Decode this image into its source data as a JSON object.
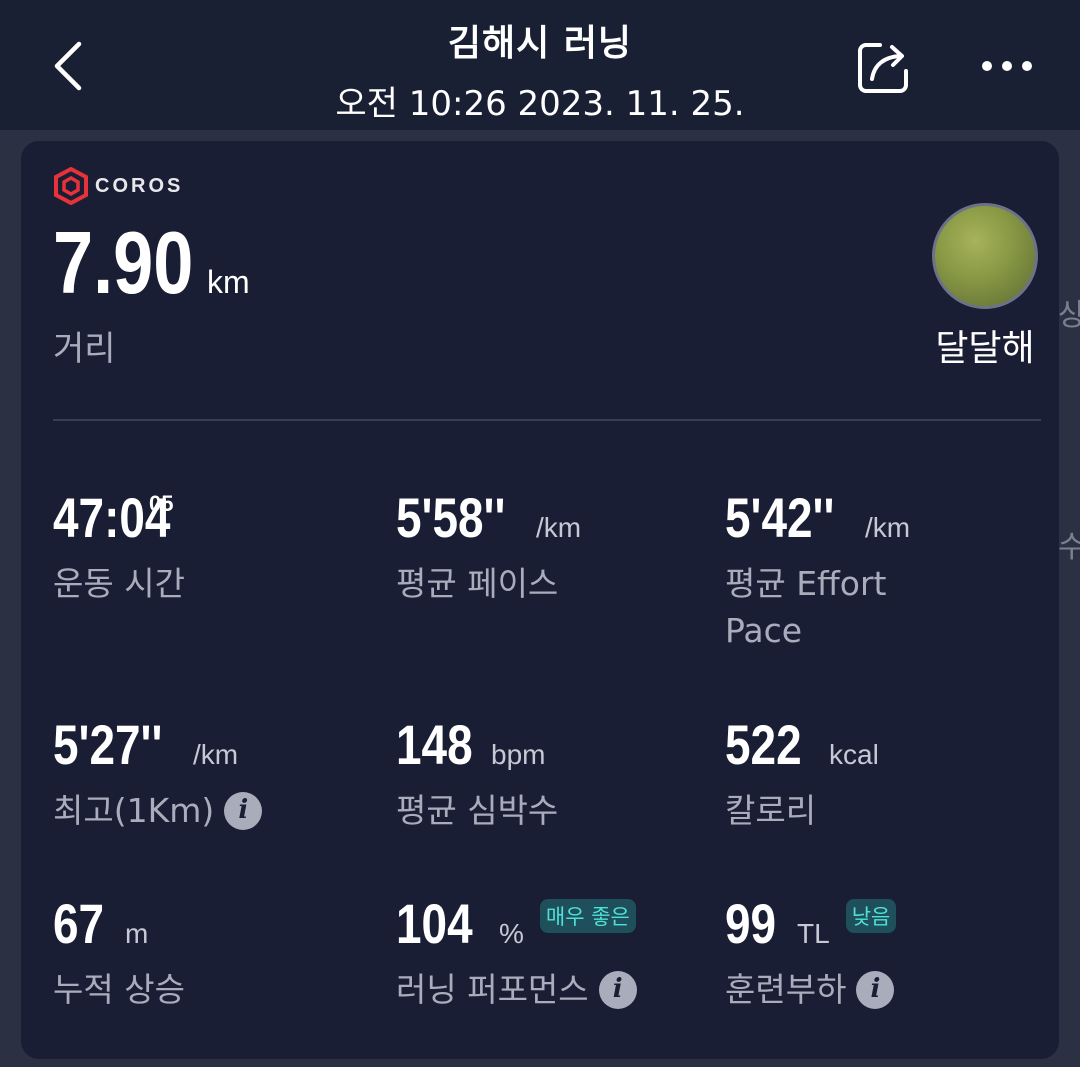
{
  "header": {
    "title": "김해시 러닝",
    "datetime": "오전 10:26 2023. 11. 25.",
    "back_icon": "chevron-left-icon",
    "share_icon": "share-icon",
    "more_icon": "more-horizontal-icon"
  },
  "map_edge": [
    "상",
    "수"
  ],
  "card": {
    "brand": "COROS",
    "brand_color": "#e8323a",
    "distance": {
      "value": "7.90",
      "unit": "km",
      "label": "거리"
    },
    "feel": {
      "label": "달달해"
    },
    "metrics": [
      {
        "value": "47:04",
        "sup": "05",
        "unit": "",
        "label": "운동 시간"
      },
      {
        "value": "5'58''",
        "unit": "/km",
        "label": "평균 페이스"
      },
      {
        "value": "5'42''",
        "unit": "/km",
        "label_line1": "평균 Effort",
        "label_line2": "Pace"
      },
      {
        "value": "5'27''",
        "unit": "/km",
        "label": "최고(1Km)",
        "info": true
      },
      {
        "value": "148",
        "unit": "bpm",
        "label": "평균 심박수"
      },
      {
        "value": "522",
        "unit": "kcal",
        "label": "칼로리"
      },
      {
        "value": "67",
        "unit": "m",
        "label": "누적 상승"
      },
      {
        "value": "104",
        "unit": "%",
        "badge": "매우 좋은",
        "label": "러닝 퍼포먼스",
        "info": true
      },
      {
        "value": "99",
        "unit": "TL",
        "badge": "낮음",
        "label": "훈련부하",
        "info": true
      }
    ],
    "accent_badge_color": "#4fe0d8"
  }
}
